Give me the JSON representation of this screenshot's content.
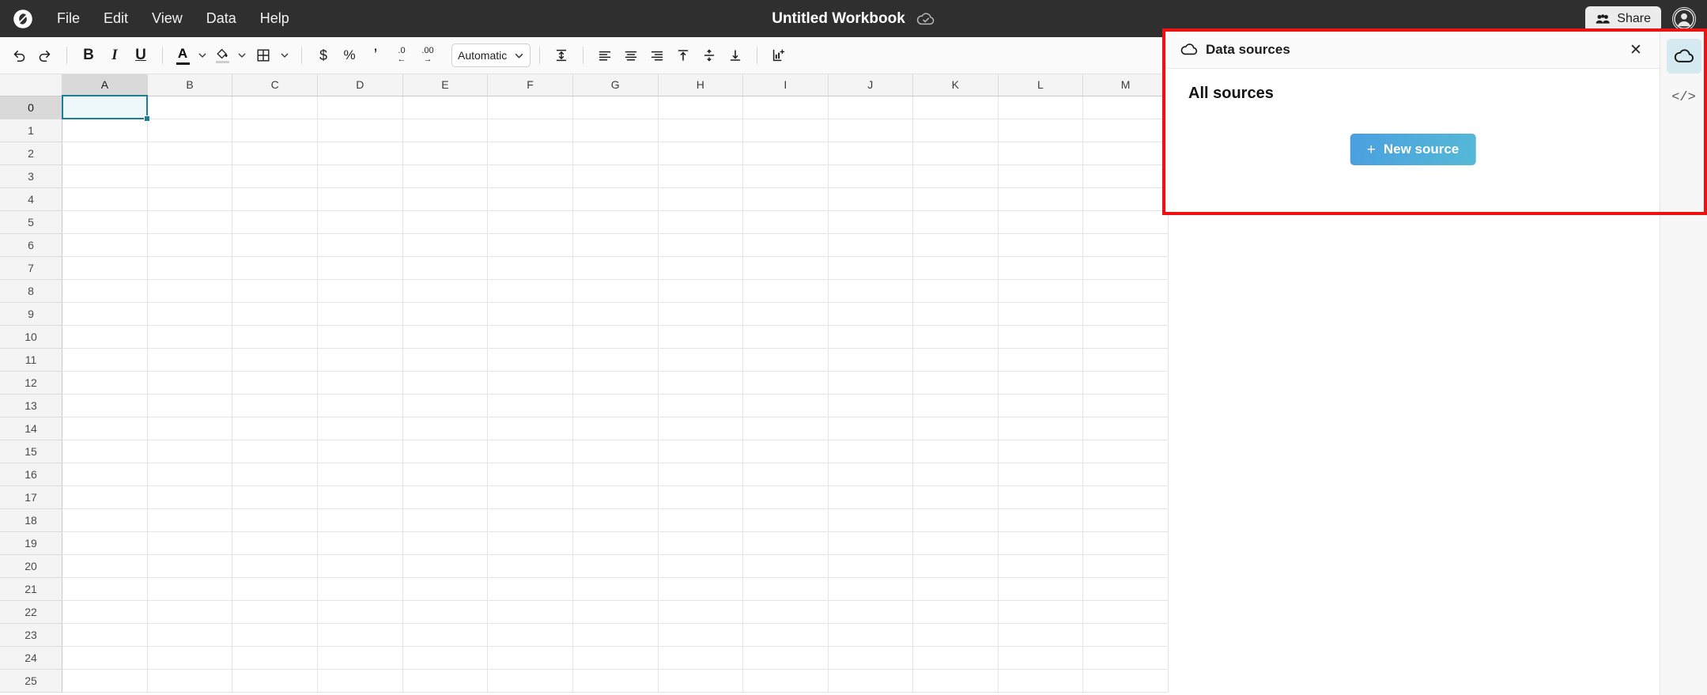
{
  "app": {
    "logo_icon": "workbook-logo-icon",
    "title": "Untitled Workbook",
    "save_status_icon": "cloud-saved-check-icon"
  },
  "menubar": {
    "items": [
      {
        "label": "File",
        "name": "menu-file"
      },
      {
        "label": "Edit",
        "name": "menu-edit"
      },
      {
        "label": "View",
        "name": "menu-view"
      },
      {
        "label": "Data",
        "name": "menu-data"
      },
      {
        "label": "Help",
        "name": "menu-help"
      }
    ]
  },
  "topbar_right": {
    "share_label": "Share",
    "share_icon": "people-group-icon",
    "avatar_icon": "user-avatar-icon"
  },
  "toolbar": {
    "undo_icon": "undo-icon",
    "redo_icon": "redo-icon",
    "bold_label": "B",
    "italic_label": "I",
    "underline_label": "U",
    "text_color_label": "A",
    "text_color_swatch": "#1a1a1a",
    "fill_color_swatch": "#cfcfcf",
    "borders_icon": "borders-grid-icon",
    "currency_label": "$",
    "percent_label": "%",
    "comma_label": "’",
    "decrease_decimal_label": ".0",
    "increase_decimal_label": ".00",
    "number_format_value": "Automatic",
    "number_format_options": [
      "Automatic"
    ],
    "wrap_icon": "text-wrap-icon",
    "align_left_icon": "align-left-icon",
    "align_center_icon": "align-center-icon",
    "align_right_icon": "align-right-icon",
    "valign_top_icon": "align-top-icon",
    "valign_middle_icon": "align-middle-icon",
    "valign_bottom_icon": "align-bottom-icon",
    "insert_chart_icon": "insert-chart-icon"
  },
  "grid": {
    "columns": [
      "A",
      "B",
      "C",
      "D",
      "E",
      "F",
      "G",
      "H",
      "I",
      "J",
      "K",
      "L",
      "M"
    ],
    "rows": [
      "0",
      "1",
      "2",
      "3",
      "4",
      "5",
      "6",
      "7",
      "8",
      "9",
      "10",
      "11",
      "12",
      "13",
      "14",
      "15",
      "16",
      "17",
      "18",
      "19",
      "20",
      "21",
      "22",
      "23",
      "24",
      "25"
    ],
    "active_column": "A",
    "active_row": "0",
    "selected_cell": "A0",
    "selection_color": "#1b7d96",
    "scrollbar_up_icon": "scroll-up-arrow-icon"
  },
  "panel": {
    "header_icon": "cloud-icon",
    "title": "Data sources",
    "close_icon": "close-icon",
    "section_title": "All sources",
    "new_source_label": "New source",
    "new_source_plus": "+",
    "new_source_color": "#4a9fe0",
    "highlight_color": "#ee1111"
  },
  "rail": {
    "items": [
      {
        "name": "rail-data-sources",
        "icon": "cloud-icon",
        "active": true
      },
      {
        "name": "rail-code-editor",
        "icon": "code-brackets-icon",
        "label": "</>",
        "active": false
      }
    ]
  }
}
